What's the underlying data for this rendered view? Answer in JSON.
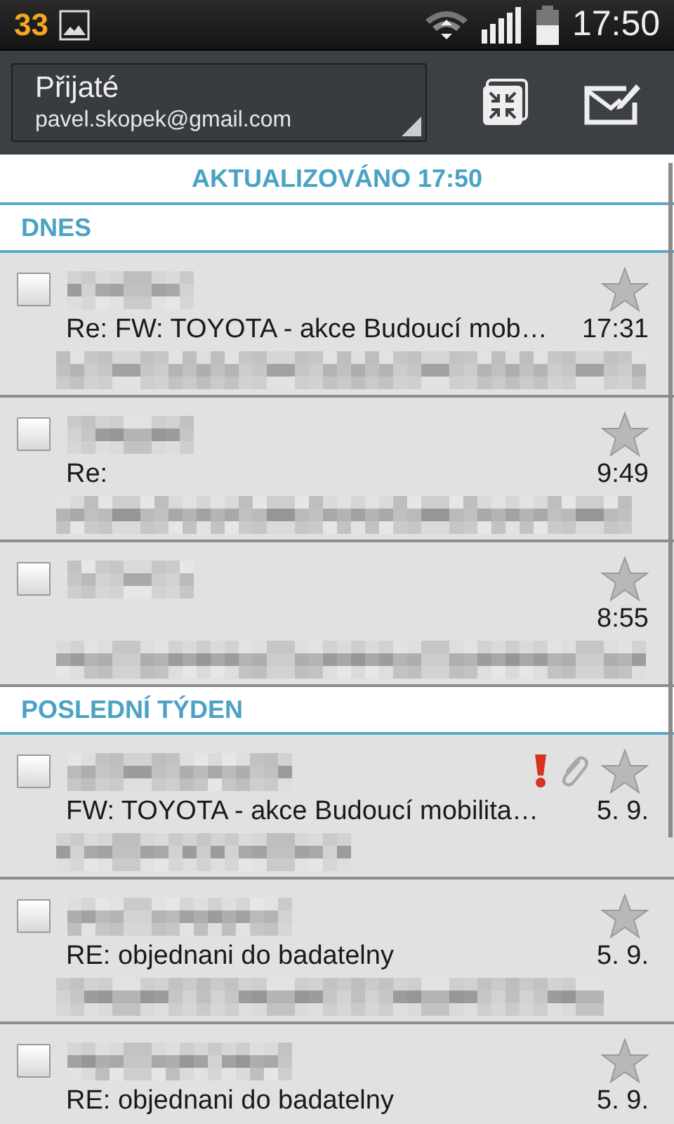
{
  "status_bar": {
    "notification_count": "33",
    "time": "17:50"
  },
  "action_bar": {
    "folder": "Přijaté",
    "account": "pavel.skopek@gmail.com"
  },
  "updated": "AKTUALIZOVÁNO 17:50",
  "sections": [
    {
      "title": "DNES",
      "messages": [
        {
          "checked": false,
          "starred": false,
          "important": false,
          "attachment": false,
          "sender_redacted": true,
          "subject": "Re: FW: TOYOTA - akce Budoucí mob…",
          "time": "17:31",
          "snippet_redacted": true
        },
        {
          "checked": false,
          "starred": false,
          "important": false,
          "attachment": false,
          "sender_redacted": true,
          "subject": "Re:",
          "time": "9:49",
          "snippet_redacted": true
        },
        {
          "checked": false,
          "starred": false,
          "important": false,
          "attachment": false,
          "sender_redacted": true,
          "time": "8:55",
          "snippet_redacted": true
        }
      ]
    },
    {
      "title": "POSLEDNÍ TÝDEN",
      "messages": [
        {
          "checked": false,
          "starred": false,
          "important": true,
          "attachment": true,
          "sender_redacted": true,
          "subject": "FW: TOYOTA - akce Budoucí mobilita…",
          "time": "5. 9.",
          "snippet_redacted": true
        },
        {
          "checked": false,
          "starred": false,
          "important": false,
          "attachment": false,
          "sender_redacted": true,
          "subject": "RE: objednani do badatelny",
          "time": "5. 9.",
          "snippet_redacted": true
        },
        {
          "checked": false,
          "starred": false,
          "important": false,
          "attachment": false,
          "sender_redacted": true,
          "subject": "RE: objednani do badatelny",
          "time": "5. 9."
        }
      ]
    }
  ]
}
